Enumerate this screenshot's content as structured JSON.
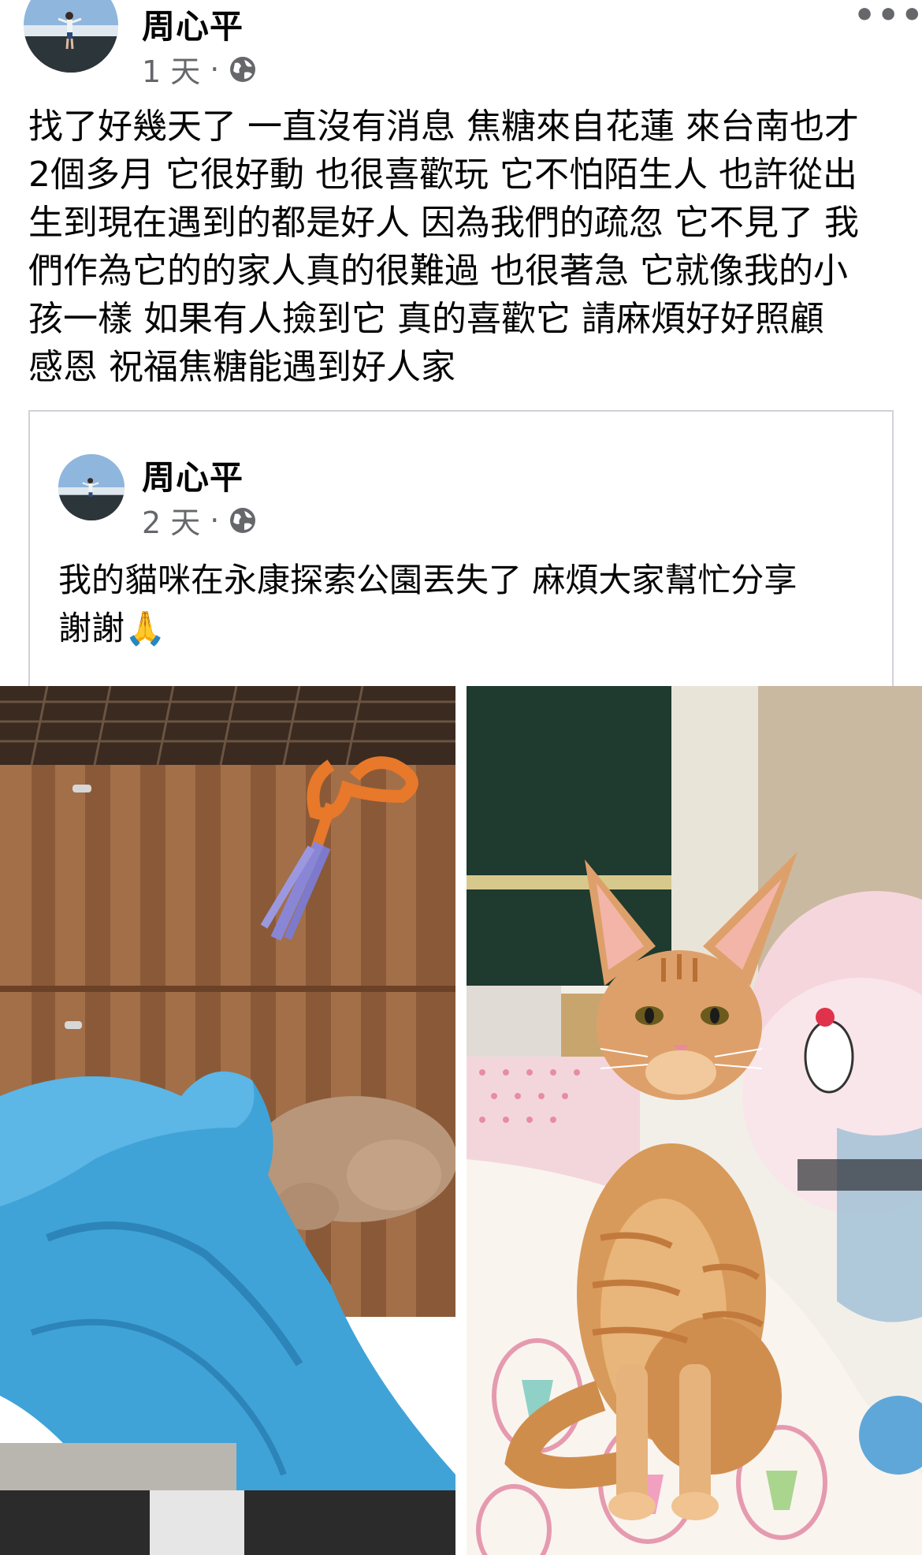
{
  "post": {
    "author": "周心平",
    "time": "1 天",
    "separator": "·",
    "privacy_icon": "globe-icon",
    "more_icon": "more-horizontal-icon",
    "more_glyph": "•••",
    "text_lines": [
      "找了好幾天了 一直沒有消息 焦糖來自花蓮 來台南也才",
      "2個多月 它很好動 也很喜歡玩 它不怕陌生人 也許從出",
      "生到現在遇到的都是好人 因為我們的疏忽 它不見了 我",
      "們作為它的的家人真的很難過 也很著急 它就像我的小",
      "孩一樣 如果有人撿到它 真的喜歡它 請麻煩好好照顧",
      "感恩 祝福焦糖能遇到好人家"
    ]
  },
  "shared_post": {
    "author": "周心平",
    "time": "2 天",
    "separator": "·",
    "privacy_icon": "globe-icon",
    "text_lines": [
      "我的貓咪在永康探索公園丟失了 麻煩大家幫忙分享",
      "謝謝🙏"
    ]
  },
  "photos": [
    {
      "name": "photo-cat-sleeping",
      "description_icon": "cat-under-blue-blanket"
    },
    {
      "name": "photo-cat-sitting",
      "description_icon": "orange-tabby-cat"
    }
  ],
  "colors": {
    "secondary_text": "#65676b",
    "border": "#cfd2d6",
    "blanket": "#3fa3d8",
    "cat": "#d89a5a"
  }
}
